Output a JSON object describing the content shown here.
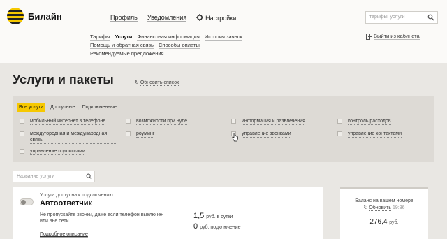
{
  "brand": {
    "name": "Билайн"
  },
  "top_nav": {
    "profile": "Профиль",
    "notifications": "Уведомления",
    "settings": "Настройки"
  },
  "search": {
    "placeholder": "тарифы, услуги"
  },
  "sub_nav": {
    "tariffs": "Тарифы",
    "services": "Услуги",
    "finance": "Финансовая информация",
    "history": "История заявок",
    "help": "Помощь и обратная связь",
    "payment": "Способы оплаты",
    "recommended": "Рекомендуемые предложения"
  },
  "logout": "Выйти из кабинета",
  "page": {
    "title": "Услуги и пакеты",
    "refresh": "Обновить список"
  },
  "tabs": {
    "all": "Все услуги",
    "available": "Доступные",
    "connected": "Подключенные"
  },
  "filters": [
    "мобильный интернет в телефоне",
    "возможности при нуле",
    "информация и развлечения",
    "контроль расходов",
    "междугородная и международная связь",
    "роуминг",
    "управление звонками",
    "управление контактами",
    "управление подписками"
  ],
  "service_search": {
    "placeholder": "Название услуги"
  },
  "service": {
    "availability": "Услуга доступна к подключению",
    "name": "Автоответчик",
    "description": "Не пропускайте звонки, даже если телефон выключен или вне сети.",
    "more": "Подробное описание",
    "daily_price": "1,5",
    "daily_unit": "руб. в сутки",
    "connect_price": "0",
    "connect_unit": "руб. подключение"
  },
  "balance": {
    "title": "Баланс на вашем номере",
    "refresh": "Обновить",
    "time": "19:36",
    "amount": "276,4",
    "currency": "руб."
  },
  "colors": {
    "accent": "#f6c800",
    "background": "#e9e7e3",
    "panel": "#dddad5"
  }
}
